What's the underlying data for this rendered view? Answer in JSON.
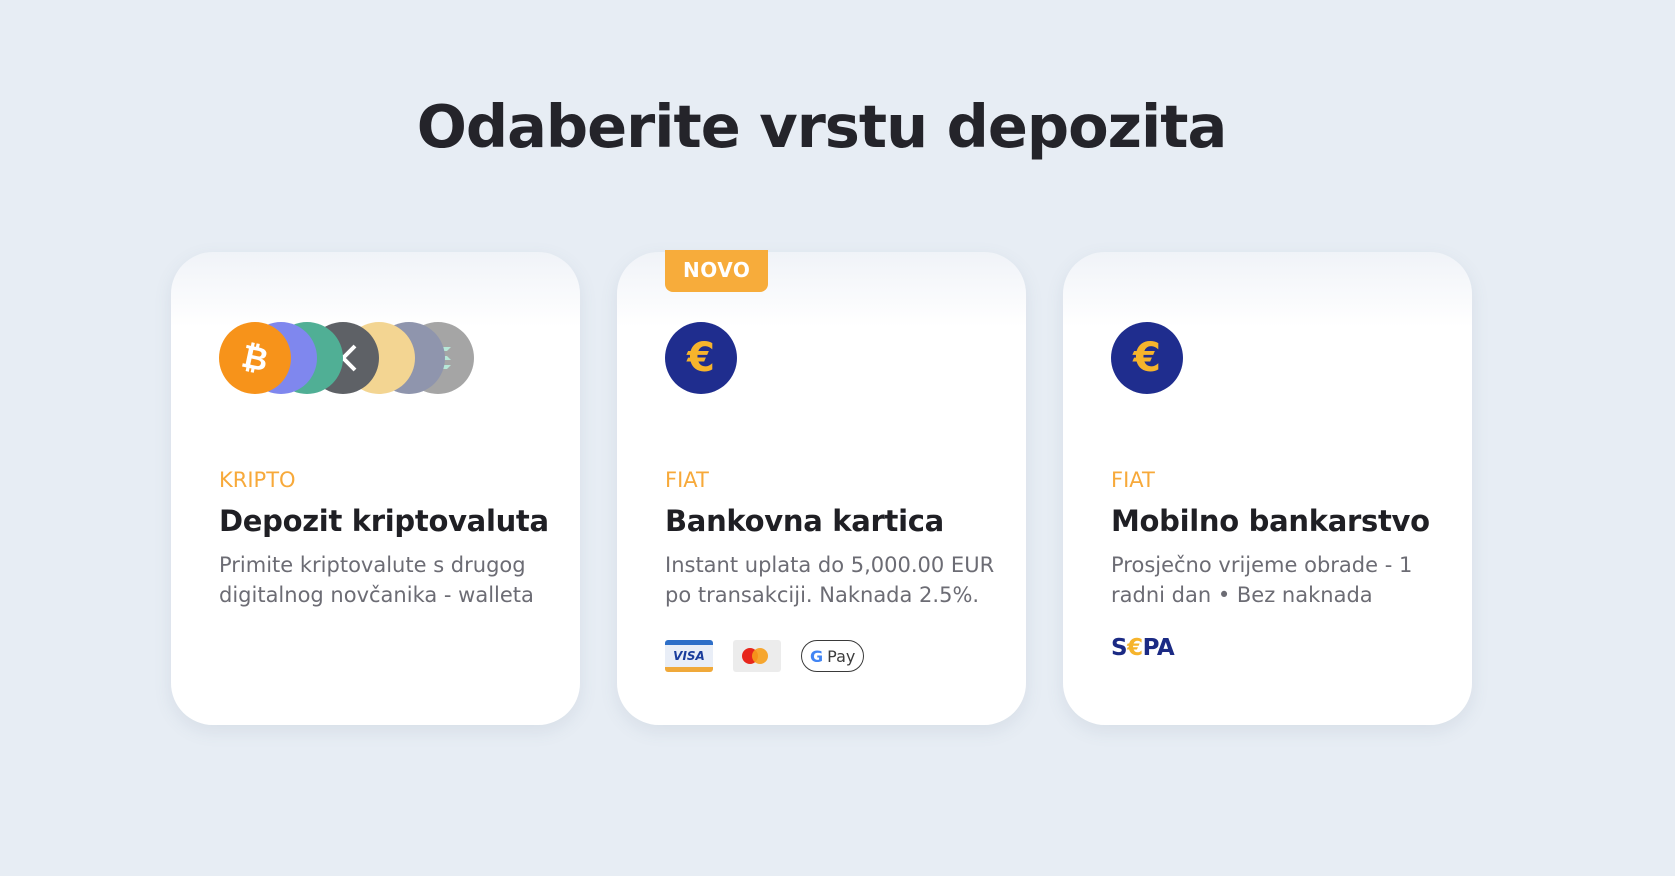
{
  "page": {
    "title": "Odaberite vrstu depozita"
  },
  "cards": [
    {
      "category": "KRIPTO",
      "title": "Depozit kriptovaluta",
      "description": "Primite kriptovalute s drugog digitalnog novčanika - walleta",
      "icons": [
        "bitcoin-icon",
        "ethereum-icon",
        "tether-icon",
        "xrp-icon",
        "bnb-icon",
        "cardano-icon",
        "solana-icon"
      ],
      "icon_colors": [
        "#f7931a",
        "#7f87ee",
        "#50af95",
        "#5e6166",
        "#f3d592",
        "#8f95ad",
        "#a5a5a5"
      ]
    },
    {
      "badge": "NOVO",
      "category": "FIAT",
      "title": "Bankovna kartica",
      "description": "Instant uplata do 5,000.00 EUR po transakciji. Naknada 2.5%.",
      "icon": "euro-icon",
      "payment_methods": {
        "visa": "VISA",
        "mastercard": "mastercard-icon",
        "gpay_g": "G",
        "gpay_text": "Pay"
      }
    },
    {
      "category": "FIAT",
      "title": "Mobilno bankarstvo",
      "description": "Prosječno vrijeme obrade - 1 radni dan • Bez naknada",
      "icon": "euro-icon",
      "sepa": {
        "s": "S",
        "euro": "€",
        "pa": "PA"
      }
    }
  ],
  "colors": {
    "background": "#e7edf4",
    "accent": "#f7ac3b",
    "euro_coin": "#1f2d8e"
  }
}
